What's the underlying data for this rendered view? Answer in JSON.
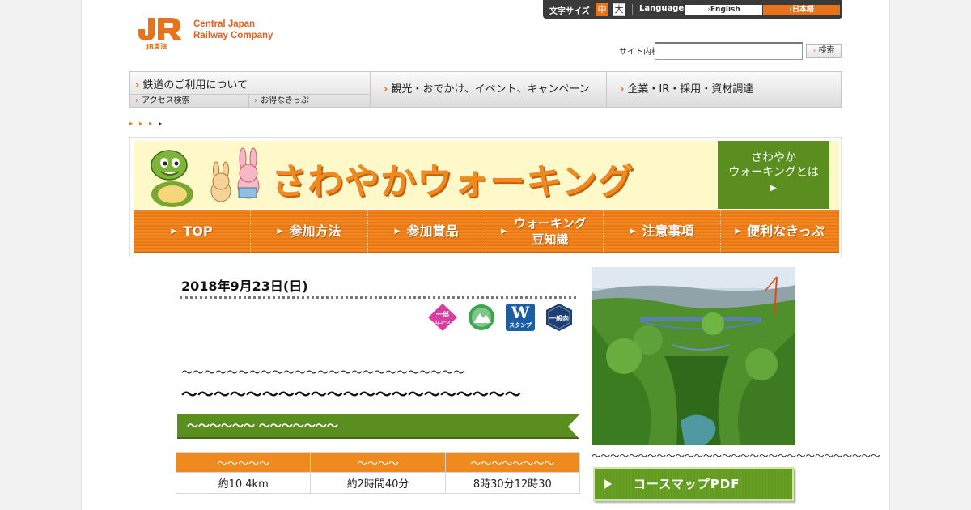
{
  "header": {
    "company_line1": "Central Japan",
    "company_line2": "Railway Company",
    "logo_text": "JR東海",
    "font_size_label": "文字サイズ",
    "font_mid": "中",
    "font_big": "大",
    "language_label": "Language",
    "lang_en": "English",
    "lang_jp": "日本語",
    "search_label": "サイト内検索",
    "search_placeholder": "",
    "search_button": "検索"
  },
  "gnav": {
    "item1": "鉄道のご利用について",
    "item1_sub1": "アクセス検索",
    "item1_sub2": "お得なきっぷ",
    "item2": "観光・おでかけ、イベント、キャンペーン",
    "item3": "企業・IR・採用・資材調達"
  },
  "banner": {
    "title": "さわやかウォーキング",
    "about_line1": "さわやか",
    "about_line2": "ウォーキングとは",
    "nav": [
      {
        "label": "TOP"
      },
      {
        "label": "参加方法"
      },
      {
        "label": "参加賞品"
      },
      {
        "label": "ウォーキング豆知識"
      },
      {
        "label": "注意事項"
      },
      {
        "label": "便利なきっぷ"
      }
    ]
  },
  "event": {
    "date": "2018年9月23日(日)",
    "badges": [
      "一部",
      "",
      "W",
      "一般向"
    ],
    "badge1_sub": "山コース",
    "badge3_sub": "スタンプ",
    "subtitle": "～～～～～～～～～～～～～～～～～～～～～～～～～",
    "title": "～～～～～～～～～～～～～～～～～～～～～",
    "section_label": "～～～～～～ ～～～～～～～",
    "table": {
      "headers": [
        "～～～～～",
        "～～～～",
        "～～～～～～～～"
      ],
      "values": [
        "約10.4km",
        "約2時間40分",
        "8時30分12時30"
      ]
    }
  },
  "side": {
    "caption": "～～～～～～～～～～～～～～～～～～～～～～～～～～～～～～～",
    "pdf_button": "コースマップPDF"
  },
  "colors": {
    "accent": "#e8731a",
    "green": "#5a8f1f",
    "banner_bg": "#fff8c8"
  }
}
